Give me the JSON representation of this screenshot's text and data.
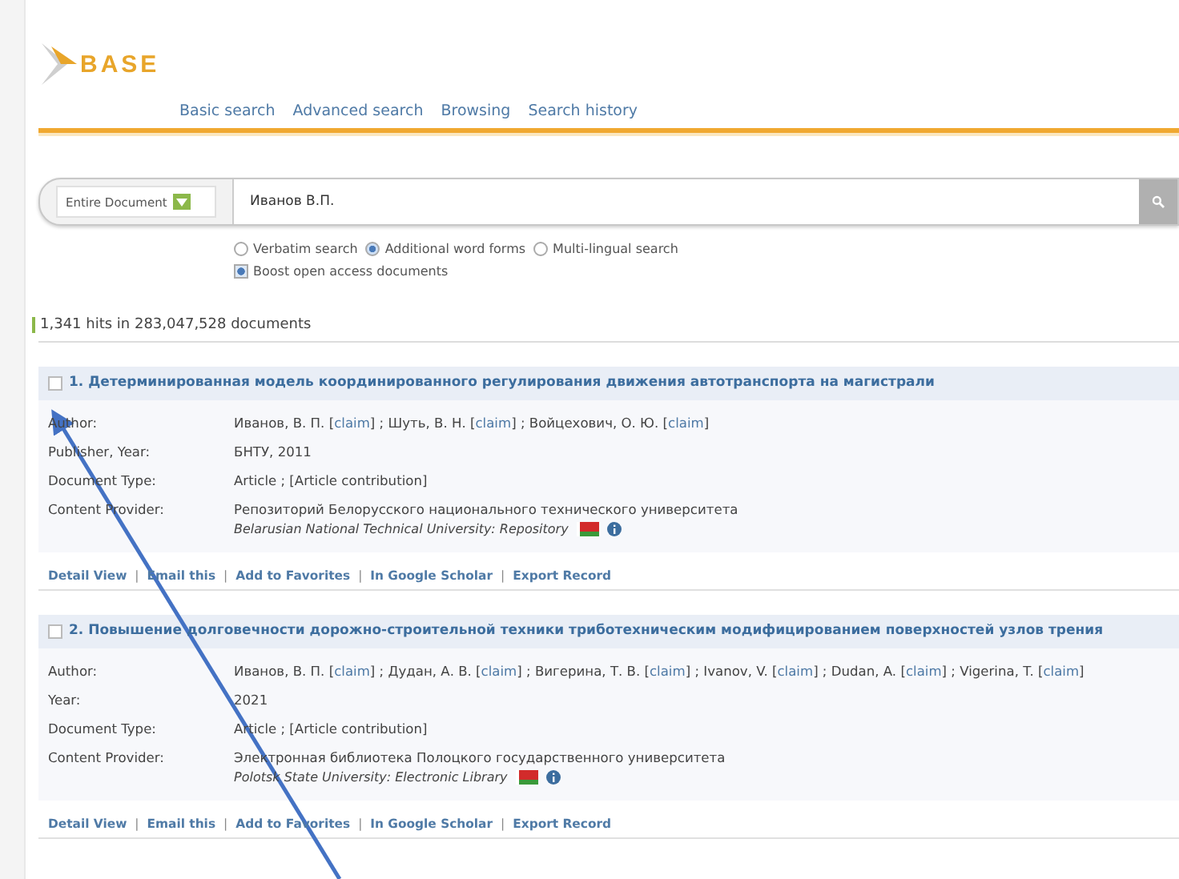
{
  "logo": {
    "text": "BASE"
  },
  "nav": [
    "Basic search",
    "Advanced search",
    "Browsing",
    "Search history"
  ],
  "search": {
    "scope": "Entire Document",
    "value": "Иванов В.П."
  },
  "options": [
    {
      "label": "Verbatim search",
      "selected": false
    },
    {
      "label": "Additional word forms",
      "selected": true
    },
    {
      "label": "Multi-lingual search",
      "selected": false
    }
  ],
  "boost": {
    "label": "Boost open access documents",
    "checked": true
  },
  "hits": "1,341 hits in 283,047,528 documents",
  "results": [
    {
      "title": "1. Детерминированная модель координированного регулирования движения автотранспорта на магистрали",
      "checked": false,
      "fields": [
        {
          "label": "Author:",
          "parts": [
            {
              "text": "Иванов, В. П. ["
            },
            {
              "text": "claim",
              "kind": "link"
            },
            {
              "text": "] ; Шуть, В. Н. ["
            },
            {
              "text": "claim",
              "kind": "link"
            },
            {
              "text": "] ; Войцехович, О. Ю. ["
            },
            {
              "text": "claim",
              "kind": "link"
            },
            {
              "text": "]"
            }
          ]
        },
        {
          "label": "Publisher, Year:",
          "parts": [
            {
              "text": "БНТУ, 2011"
            }
          ]
        },
        {
          "label": "Document Type:",
          "parts": [
            {
              "text": "Article ; [Article contribution]"
            }
          ]
        }
      ],
      "provider": {
        "label": "Content Provider:",
        "name": "Репозиторий Белорусского национального технического университета",
        "english": "Belarusian National Technical University: Repository"
      },
      "actions": [
        "Detail View",
        "Email this",
        "Add to Favorites",
        "In Google Scholar",
        "Export Record"
      ]
    },
    {
      "title": "2. Повышение долговечности дорожно-строительной техники триботехническим модифицированием поверхностей узлов трения",
      "checked": false,
      "fields": [
        {
          "label": "Author:",
          "parts": [
            {
              "text": "Иванов, В. П. ["
            },
            {
              "text": "claim",
              "kind": "link"
            },
            {
              "text": "] ; Дудан, А. В. ["
            },
            {
              "text": "claim",
              "kind": "link"
            },
            {
              "text": "] ; Вигерина, Т. В. ["
            },
            {
              "text": "claim",
              "kind": "link"
            },
            {
              "text": "] ; Ivanov, V. ["
            },
            {
              "text": "claim",
              "kind": "link"
            },
            {
              "text": "] ; Dudan, A. ["
            },
            {
              "text": "claim",
              "kind": "link"
            },
            {
              "text": "] ; Vigerina, T. ["
            },
            {
              "text": "claim",
              "kind": "link"
            },
            {
              "text": "]"
            }
          ]
        },
        {
          "label": "Year:",
          "parts": [
            {
              "text": "2021"
            }
          ]
        },
        {
          "label": "Document Type:",
          "parts": [
            {
              "text": "Article ; [Article contribution]"
            }
          ]
        }
      ],
      "provider": {
        "label": "Content Provider:",
        "name": "Электронная библиотека Полоцкого государственного университета",
        "english": "Polotsk State University: Electronic Library"
      },
      "actions": [
        "Detail View",
        "Email this",
        "Add to Favorites",
        "In Google Scholar",
        "Export Record"
      ]
    }
  ],
  "action_separator": "|"
}
